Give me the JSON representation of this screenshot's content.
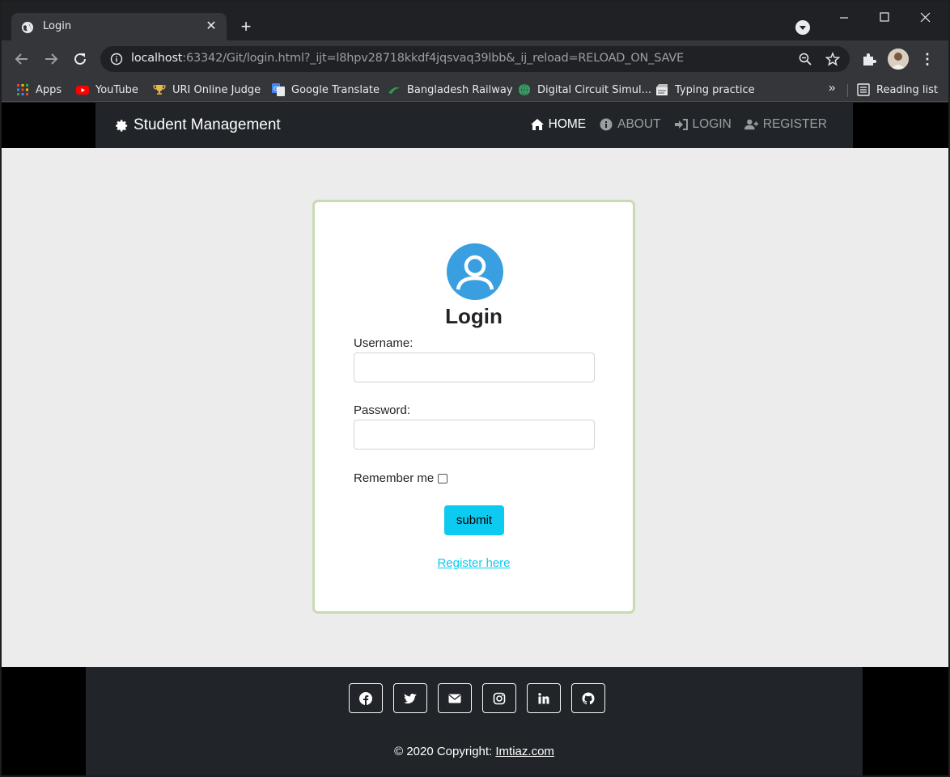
{
  "browser": {
    "tab_title": "Login",
    "url_host": "localhost",
    "url_rest": ":63342/Git/login.html?_ijt=l8hpv28718kkdf4jqsvaq39lbb&_ij_reload=RELOAD_ON_SAVE",
    "bookmarks": [
      {
        "label": "Apps",
        "icon": "apps-grid-icon"
      },
      {
        "label": "YouTube",
        "icon": "youtube-icon"
      },
      {
        "label": "URI Online Judge",
        "icon": "trophy-icon"
      },
      {
        "label": "Google Translate",
        "icon": "translate-icon"
      },
      {
        "label": "Bangladesh Railway",
        "icon": "railway-icon"
      },
      {
        "label": "Digital Circuit Simul...",
        "icon": "globe-icon"
      },
      {
        "label": "Typing practice",
        "icon": "typing-icon"
      }
    ],
    "more": "»",
    "reading_list": "Reading list"
  },
  "navbar": {
    "brand": "Student Management",
    "links": [
      {
        "label": "HOME",
        "icon": "home-icon",
        "active": true
      },
      {
        "label": "ABOUT",
        "icon": "info-icon",
        "active": false
      },
      {
        "label": "LOGIN",
        "icon": "sign-in-icon",
        "active": false
      },
      {
        "label": "REGISTER",
        "icon": "user-plus-icon",
        "active": false
      }
    ]
  },
  "login": {
    "title": "Login",
    "username_label": "Username:",
    "username_value": "",
    "password_label": "Password:",
    "password_value": "",
    "remember_label": "Remember me",
    "remember_checked": false,
    "submit_label": "submit",
    "register_link": "Register here"
  },
  "footer": {
    "socials": [
      "facebook-icon",
      "twitter-icon",
      "envelope-icon",
      "instagram-icon",
      "linkedin-icon",
      "github-icon"
    ],
    "copyright_prefix": "© 2020 Copyright: ",
    "copyright_link": "Imtiaz.com"
  },
  "colors": {
    "accent": "#0dcaf0",
    "navbar_bg": "#212529",
    "card_border": "#c8dbb0",
    "avatar": "#3a9fe0"
  }
}
